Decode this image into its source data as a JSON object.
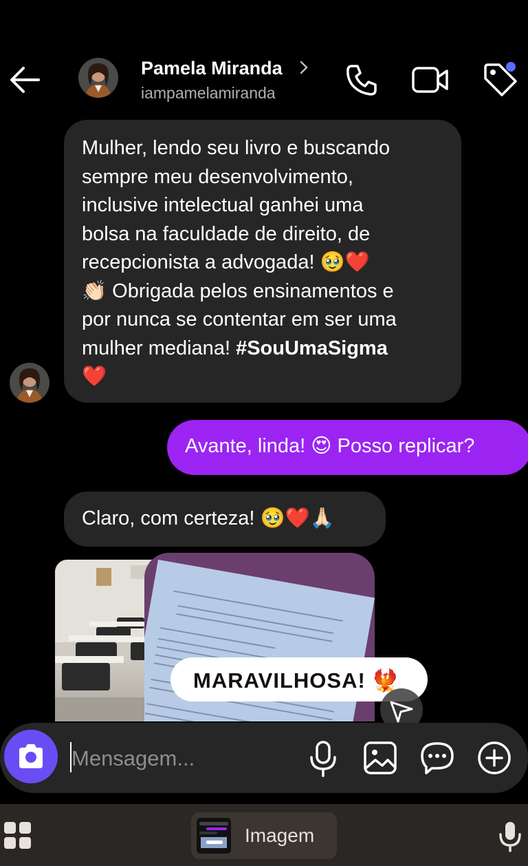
{
  "header": {
    "back_icon": "arrow-left-icon",
    "contact_name": "Pamela Miranda",
    "contact_handle": "iampamelamiranda",
    "icons": [
      "phone-icon",
      "video-camera-icon",
      "tag-icon"
    ],
    "notification_dot_color": "#5b6cff"
  },
  "messages": [
    {
      "direction": "incoming",
      "lines": [
        "Mulher, lendo seu livro e buscando",
        "sempre meu desenvolvimento,",
        "inclusive intelectual ganhei uma",
        "bolsa na faculdade de direito, de",
        "recepcionista a advogada! 🥹❤️",
        "👏🏻 Obrigada pelos ensinamentos e",
        "por nunca se contentar em ser uma",
        "mulher mediana! "
      ],
      "hashtag": "#SouUmaSigma",
      "trailing": "❤️"
    },
    {
      "direction": "outgoing",
      "text": "Avante, linda! 😍 Posso replicar?"
    },
    {
      "direction": "incoming",
      "text": "Claro, com certeza! 🥹❤️🙏🏻"
    }
  ],
  "shared_story": {
    "reply_text": "MARAVILHOSA! 🐦‍🔥"
  },
  "composer": {
    "placeholder": "Mensagem...",
    "icons": [
      "camera-icon",
      "microphone-icon",
      "image-icon",
      "sticker-icon",
      "plus-icon"
    ]
  },
  "keyboard_bar": {
    "clipboard_label": "Imagem"
  },
  "colors": {
    "background": "#000000",
    "incoming_bubble": "#262626",
    "outgoing_bubble": "#9b24f2",
    "camera_button": "#6a4cf5"
  }
}
